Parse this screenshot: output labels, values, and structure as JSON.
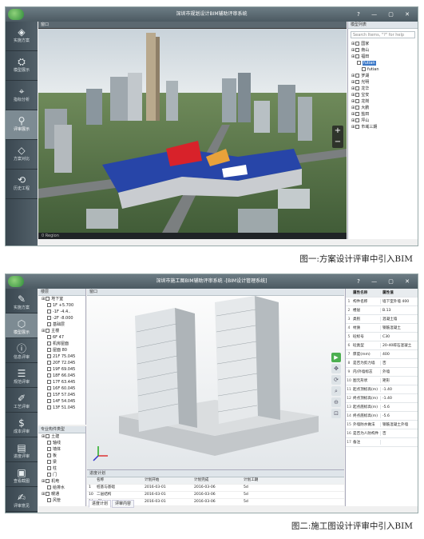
{
  "figure1": {
    "window_title": "深圳市规划设计BIM辅助评审系统",
    "caption": "图一:方案设计评审中引入BIM",
    "viewport_label": "窗口",
    "nav": [
      {
        "label": "实施方案",
        "icon": "layers-icon"
      },
      {
        "label": "模型展示",
        "icon": "model-icon"
      },
      {
        "label": "指标分析",
        "icon": "pin-icon"
      },
      {
        "label": "评审展示",
        "icon": "review-icon"
      },
      {
        "label": "方案对比",
        "icon": "compare-icon"
      },
      {
        "label": "历史工程",
        "icon": "history-icon"
      }
    ],
    "tree_title": "模型列表",
    "search_placeholder": "Search Items, \"?\" for help",
    "tree_items": [
      {
        "label": "国家",
        "level": 0
      },
      {
        "label": "南山",
        "level": 0
      },
      {
        "label": "福田",
        "level": 0
      },
      {
        "label": "futian",
        "level": 1,
        "selected": true
      },
      {
        "label": "futian",
        "level": 2
      },
      {
        "label": "罗湖",
        "level": 0
      },
      {
        "label": "光明",
        "level": 0
      },
      {
        "label": "龙华",
        "level": 0
      },
      {
        "label": "宝安",
        "level": 0
      },
      {
        "label": "龙岗",
        "level": 0
      },
      {
        "label": "大鹏",
        "level": 0
      },
      {
        "label": "盐田",
        "level": 0
      },
      {
        "label": "坪山",
        "level": 0
      },
      {
        "label": "市域三期",
        "level": 0
      }
    ],
    "status": "0  Region"
  },
  "figure2": {
    "window_title": "深圳市施工图BIM辅助评审系统 -[BIM设计管理系统]",
    "caption": "图二:施工图设计评审中引入BIM",
    "viewport_label": "窗口",
    "nav": [
      {
        "label": "实施方案",
        "icon": "pencil-icon"
      },
      {
        "label": "模型展示",
        "icon": "cube-icon"
      },
      {
        "label": "信息评审",
        "icon": "info-icon"
      },
      {
        "label": "规范评审",
        "icon": "rule-icon"
      },
      {
        "label": "工艺评审",
        "icon": "edit-icon"
      },
      {
        "label": "成本评审",
        "icon": "money-icon"
      },
      {
        "label": "进度评审",
        "icon": "schedule-icon"
      },
      {
        "label": "查看截图",
        "icon": "screenshot-icon"
      },
      {
        "label": "评审意见",
        "icon": "comment-icon"
      }
    ],
    "model_tree_title": "楼层",
    "model_tree": [
      {
        "label": "地下室",
        "level": 0
      },
      {
        "label": "1F +5.700",
        "level": 1
      },
      {
        "label": "-1F -4.4..",
        "level": 1
      },
      {
        "label": "-2F -8.000",
        "level": 1
      },
      {
        "label": "基础层",
        "level": 1
      },
      {
        "label": "主楼",
        "level": 0
      },
      {
        "label": "6F 47",
        "level": 1
      },
      {
        "label": "机房屋面",
        "level": 1
      },
      {
        "label": "屋面 80",
        "level": 1
      },
      {
        "label": "21F 75.045",
        "level": 1
      },
      {
        "label": "20F 72.045",
        "level": 1
      },
      {
        "label": "19F 69.045",
        "level": 1
      },
      {
        "label": "18F 66.045",
        "level": 1
      },
      {
        "label": "17F 63.445",
        "level": 1
      },
      {
        "label": "16F 60.045",
        "level": 1
      },
      {
        "label": "15F 57.045",
        "level": 1
      },
      {
        "label": "14F 54.045",
        "level": 1
      },
      {
        "label": "13F 51.045",
        "level": 1
      }
    ],
    "category_title": "专业构件类型",
    "categories": [
      {
        "label": "土建",
        "level": 0
      },
      {
        "label": "轴线",
        "level": 1
      },
      {
        "label": "墙体",
        "level": 1
      },
      {
        "label": "板",
        "level": 1
      },
      {
        "label": "梁",
        "level": 1
      },
      {
        "label": "柱",
        "level": 1
      },
      {
        "label": "门",
        "level": 1
      },
      {
        "label": "机电",
        "level": 0
      },
      {
        "label": "给排水",
        "level": 1
      },
      {
        "label": "暖通",
        "level": 0
      },
      {
        "label": "风管",
        "level": 1
      }
    ],
    "props_headers": [
      "属性名称",
      "属性值"
    ],
    "props": [
      {
        "key": "构件名称",
        "value": "墙下室外墙 400"
      },
      {
        "key": "楼层",
        "value": "B.13"
      },
      {
        "key": "类别",
        "value": "混凝土墙"
      },
      {
        "key": "材质",
        "value": "钢筋混凝土"
      },
      {
        "key": "砼标号",
        "value": "C30"
      },
      {
        "key": "砼类型",
        "value": "20-40碎石混凝土"
      },
      {
        "key": "厚度(mm)",
        "value": "400"
      },
      {
        "key": "是否为剪力墙",
        "value": "否"
      },
      {
        "key": "内/外墙标志",
        "value": "外墙"
      },
      {
        "key": "图元形状",
        "value": "矩形"
      },
      {
        "key": "起点顶标高(m)",
        "value": "-1.40"
      },
      {
        "key": "终点顶标高(m)",
        "value": "-1.40"
      },
      {
        "key": "起点底标高(m)",
        "value": "-5.6"
      },
      {
        "key": "终点底标高(m)",
        "value": "-5.6"
      },
      {
        "key": "外墙防水做法",
        "value": "钢筋混凝土外墙"
      },
      {
        "key": "是否为人防构件",
        "value": "否"
      },
      {
        "key": "备注",
        "value": ""
      }
    ],
    "schedule_title": "进度计划",
    "schedule_headers": [
      "",
      "名称",
      "计划开始",
      "计划完成",
      "计划工期",
      ""
    ],
    "schedule_rows": [
      [
        "1",
        "桩基与基础",
        "2016-03-01",
        "2016-03-06",
        "5d",
        ""
      ],
      [
        "10",
        "二层结构",
        "2016-03-01",
        "2016-03-06",
        "5d",
        ""
      ],
      [
        "14",
        "-F1",
        "2016-03-01",
        "2016-03-06",
        "5d",
        ""
      ]
    ],
    "schedule_tabs": [
      "进度计划",
      "评审内容"
    ]
  }
}
